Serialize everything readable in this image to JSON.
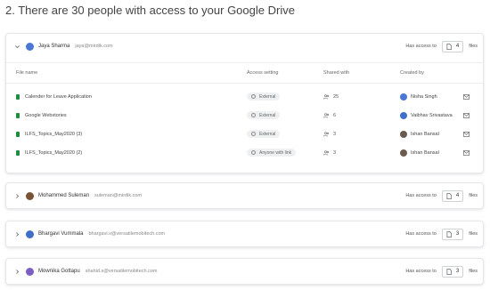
{
  "heading": "2.  There are 30 people with access to your Google Drive",
  "labels": {
    "has_access_to": "Has access to",
    "files": "files"
  },
  "columns": {
    "file_name": "File name",
    "access_setting": "Access setting",
    "shared_with": "Shared with",
    "created_by": "Created by"
  },
  "users": [
    {
      "name": "Jaya Sharma",
      "email": "jaya@mirdik.com",
      "file_count": "4",
      "expanded": true,
      "avatar_color": "#4a77d4",
      "files": [
        {
          "name": "Calender for Leave Application",
          "access": "External",
          "shared": "25",
          "creator": "Nisha Singh",
          "creator_color": "#4a77d4"
        },
        {
          "name": "Google Webstories",
          "access": "External",
          "shared": "6",
          "creator": "Vaibhav Srivastava",
          "creator_color": "#3f6fc9"
        },
        {
          "name": "ILFS_Topics_May2020 (3)",
          "access": "External",
          "shared": "3",
          "creator": "Ishan Bansal",
          "creator_color": "#6b5b4e"
        },
        {
          "name": "ILFS_Topics_May2020 (2)",
          "access": "Anyone with link",
          "shared": "3",
          "creator": "Ishan Bansal",
          "creator_color": "#6b5b4e"
        }
      ]
    },
    {
      "name": "Mohammed Suleman",
      "email": "suleman@mirdik.com",
      "file_count": "4",
      "expanded": false,
      "avatar_color": "#7a5236"
    },
    {
      "name": "Bhargavi Vummala",
      "email": "bhargavi.v@versatilemobitech.com",
      "file_count": "3",
      "expanded": false,
      "avatar_color": "#3f6fc9"
    },
    {
      "name": "Mownika Gottapu",
      "email": "shahid.s@versatilemobitech.com",
      "file_count": "3",
      "expanded": false,
      "avatar_color": "#7b5fc4"
    }
  ]
}
